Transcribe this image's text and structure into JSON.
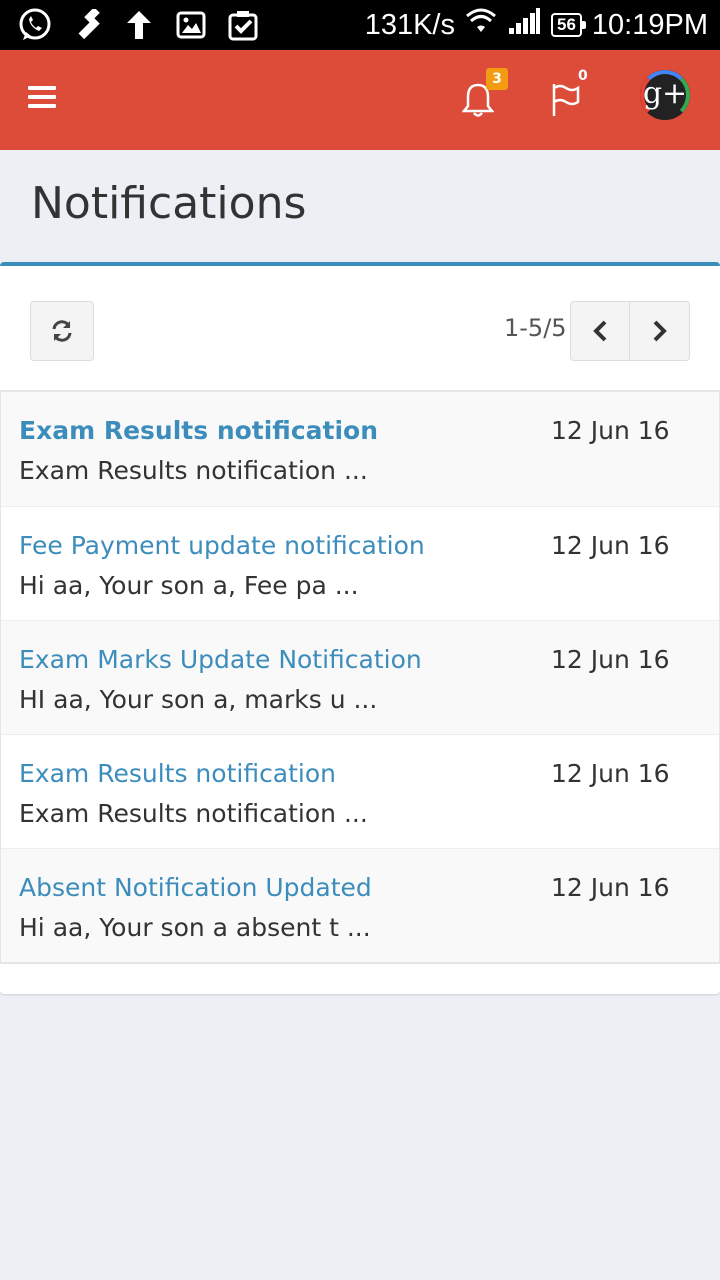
{
  "status_bar": {
    "speed": "131K/s",
    "battery": "56",
    "time": "10:19PM",
    "icons": [
      "whatsapp-icon",
      "hammer-icon",
      "upload-icon",
      "image-icon",
      "clipboard-check-icon",
      "wifi-icon",
      "signal-icon",
      "battery-icon"
    ]
  },
  "header": {
    "bell_count": "3",
    "flag_count": "0",
    "avatar_letter": "g+",
    "colors": {
      "header_bg": "#dd4b39",
      "badge": "#f39c12"
    }
  },
  "page": {
    "title": "Notifications"
  },
  "toolbar": {
    "pager_text": "1-5/5"
  },
  "notifications": [
    {
      "title": "Exam Results notification",
      "date": "12 Jun 16",
      "snippet": "Exam Results notification ...",
      "unread": true
    },
    {
      "title": "Fee Payment update notification",
      "date": "12 Jun 16",
      "snippet": "Hi aa, Your son a, Fee pa ...",
      "unread": false
    },
    {
      "title": "Exam Marks Update Notification",
      "date": "12 Jun 16",
      "snippet": "HI aa, Your son a, marks u ...",
      "unread": false
    },
    {
      "title": "Exam Results notification",
      "date": "12 Jun 16",
      "snippet": "Exam Results notification ...",
      "unread": false
    },
    {
      "title": "Absent Notification Updated",
      "date": "12 Jun 16",
      "snippet": "Hi aa, Your son a absent t ...",
      "unread": false
    }
  ],
  "colors": {
    "accent": "#3c8dbc",
    "page_bg": "#ecf0f5"
  }
}
